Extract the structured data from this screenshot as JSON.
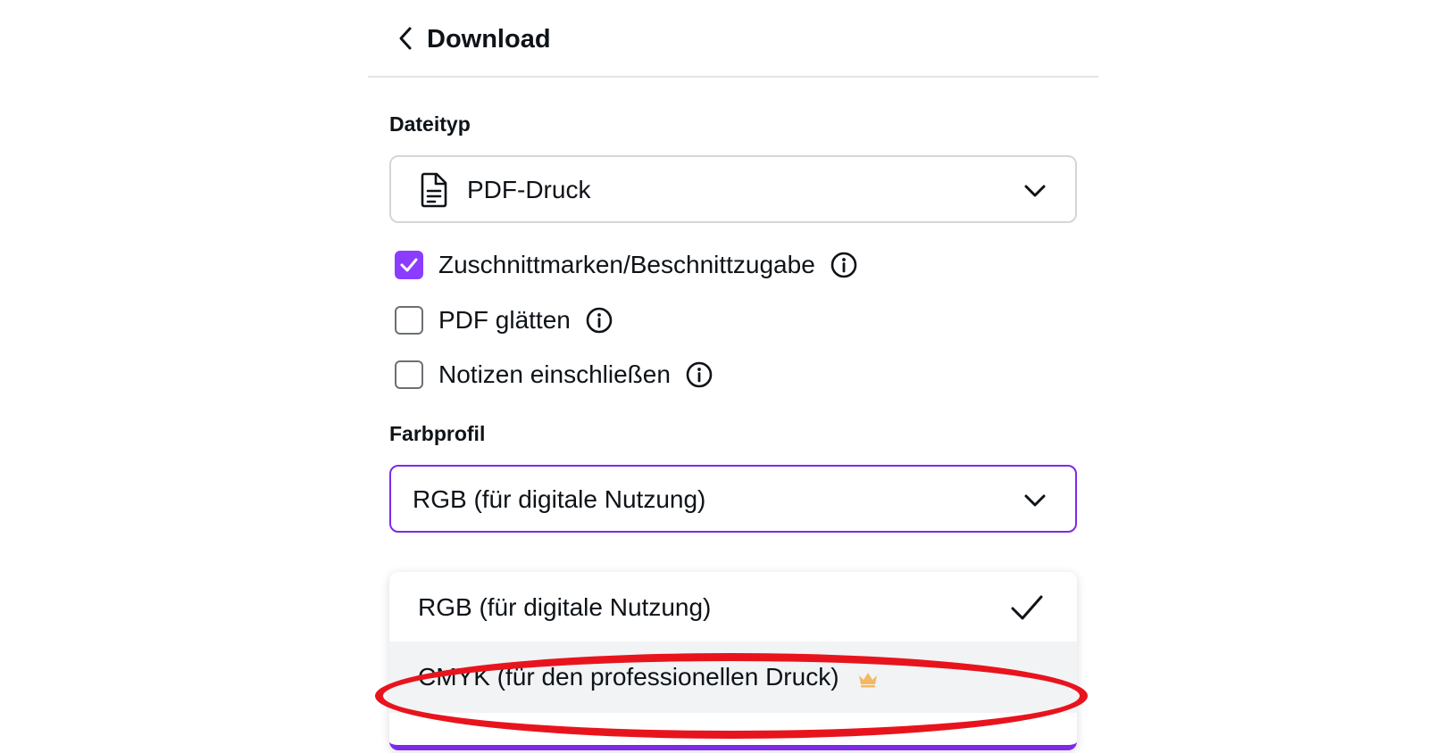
{
  "header": {
    "title": "Download",
    "back_icon": "chevron-left-icon"
  },
  "file_type": {
    "label": "Dateityp",
    "selected": "PDF-Druck",
    "icon": "file-document-icon"
  },
  "options": [
    {
      "label": "Zuschnittmarken/Beschnittzugabe",
      "checked": true
    },
    {
      "label": "PDF glätten",
      "checked": false
    },
    {
      "label": "Notizen einschließen",
      "checked": false
    }
  ],
  "color_profile": {
    "label": "Farbprofil",
    "selected": "RGB (für digitale Nutzung)",
    "menu": [
      {
        "label": "RGB (für digitale Nutzung)",
        "selected": true,
        "premium": false
      },
      {
        "label": "CMYK (für den professionellen Druck)",
        "selected": false,
        "premium": true
      }
    ]
  },
  "colors": {
    "accent": "#8b3dff",
    "focus_border": "#7d2ae8",
    "annotation": "#e8141d",
    "crown": "#f4b860"
  }
}
